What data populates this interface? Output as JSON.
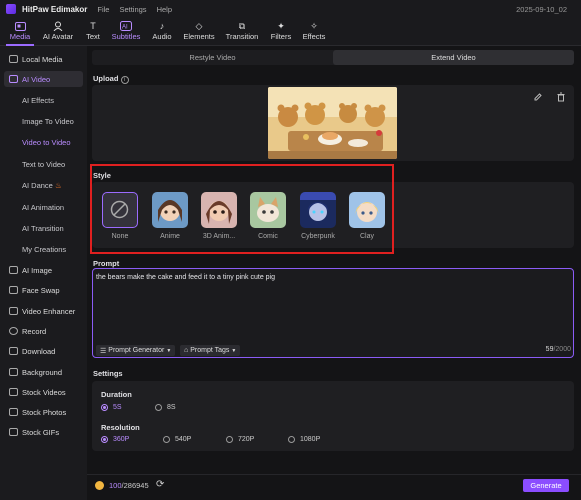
{
  "app": {
    "name": "HitPaw Edimakor",
    "menus": [
      "File",
      "Settings",
      "Help"
    ],
    "date": "2025-09-10_02"
  },
  "toolbar": [
    {
      "label": "Media",
      "icon": "media-icon",
      "active": true
    },
    {
      "label": "AI Avatar",
      "icon": "avatar-icon"
    },
    {
      "label": "Text",
      "icon": "text-icon"
    },
    {
      "label": "Subtitles",
      "icon": "subtitles-icon"
    },
    {
      "label": "Audio",
      "icon": "audio-icon"
    },
    {
      "label": "Elements",
      "icon": "elements-icon"
    },
    {
      "label": "Transition",
      "icon": "transition-icon"
    },
    {
      "label": "Filters",
      "icon": "filters-icon"
    },
    {
      "label": "Effects",
      "icon": "effects-icon"
    }
  ],
  "sidebar": {
    "items": [
      {
        "label": "Local Media"
      },
      {
        "label": "AI Video",
        "active": true
      },
      {
        "label": "AI Image"
      },
      {
        "label": "Face Swap"
      },
      {
        "label": "Video Enhancer"
      },
      {
        "label": "Record"
      },
      {
        "label": "Download"
      },
      {
        "label": "Background"
      },
      {
        "label": "Stock Videos"
      },
      {
        "label": "Stock Photos"
      },
      {
        "label": "Stock GIFs"
      }
    ],
    "subitems": [
      {
        "label": "AI Effects"
      },
      {
        "label": "Image To Video"
      },
      {
        "label": "Video to Video",
        "selected": true
      },
      {
        "label": "Text to Video"
      },
      {
        "label": "AI Dance",
        "badge": "fire-icon"
      },
      {
        "label": "AI Animation"
      },
      {
        "label": "AI Transition"
      },
      {
        "label": "My Creations"
      }
    ]
  },
  "tabs": [
    "Restyle Video",
    "Extend Video"
  ],
  "upload": {
    "label": "Upload",
    "info_icon": "info-icon"
  },
  "style": {
    "label": "Style",
    "options": [
      "None",
      "Anime",
      "3D Anim...",
      "Comic",
      "Cyberpunk",
      "Clay"
    ],
    "highlight_color": "#e02020"
  },
  "prompt": {
    "label": "Prompt",
    "text": "the bears make the cake and feed it to a tiny pink cute pig",
    "generator_label": "Prompt Generator",
    "tags_label": "Prompt Tags",
    "count": "59",
    "max": "/2000"
  },
  "settings": {
    "label": "Settings",
    "duration": {
      "label": "Duration",
      "options": [
        "5S",
        "8S"
      ],
      "selected": "5S"
    },
    "resolution": {
      "label": "Resolution",
      "options": [
        "360P",
        "540P",
        "720P",
        "1080P"
      ],
      "selected": "360P"
    }
  },
  "footer": {
    "credits_used": "100",
    "credits_total": "/286945",
    "generate_label": "Generate"
  },
  "accent": "#9b6bff"
}
